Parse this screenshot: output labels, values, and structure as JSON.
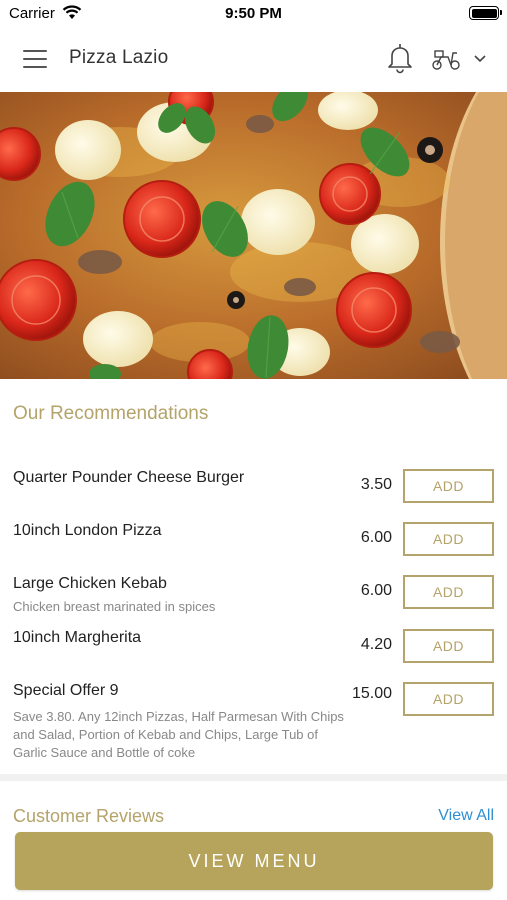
{
  "status_bar": {
    "carrier": "Carrier",
    "time": "9:50 PM"
  },
  "header": {
    "title": "Pizza Lazio",
    "icons": [
      "hamburger-menu-icon",
      "bell-icon",
      "scooter-icon",
      "chevron-down-icon"
    ]
  },
  "recommendations": {
    "title": "Our Recommendations",
    "add_label": "ADD",
    "items": [
      {
        "name": "Quarter Pounder Cheese Burger",
        "description": "",
        "price": "3.50"
      },
      {
        "name": "10inch London Pizza",
        "description": "",
        "price": "6.00"
      },
      {
        "name": "Large Chicken Kebab",
        "description": "Chicken breast marinated in spices",
        "price": "6.00"
      },
      {
        "name": "10inch Margherita",
        "description": "",
        "price": "4.20"
      },
      {
        "name": "Special Offer 9",
        "description": "Save 3.80. Any 12inch Pizzas, Half Parmesan With Chips and Salad, Portion of Kebab and Chips, Large Tub of Garlic Sauce and Bottle of coke",
        "price": "15.00"
      }
    ]
  },
  "reviews": {
    "title": "Customer Reviews",
    "view_all": "View All"
  },
  "footer": {
    "view_menu": "VIEW MENU"
  },
  "colors": {
    "accent": "#b7a45c",
    "link": "#2f8fd1"
  }
}
